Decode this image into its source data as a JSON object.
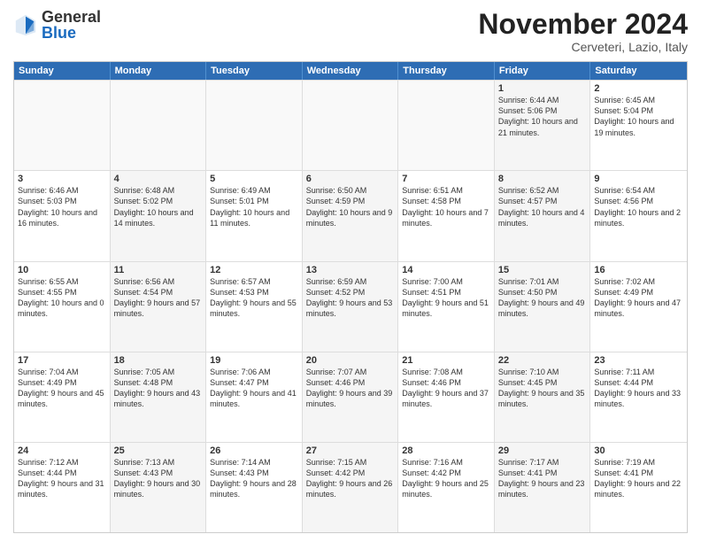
{
  "logo": {
    "general": "General",
    "blue": "Blue"
  },
  "title": "November 2024",
  "location": "Cerveteri, Lazio, Italy",
  "header_days": [
    "Sunday",
    "Monday",
    "Tuesday",
    "Wednesday",
    "Thursday",
    "Friday",
    "Saturday"
  ],
  "rows": [
    [
      {
        "day": "",
        "info": "",
        "shaded": false,
        "empty": true
      },
      {
        "day": "",
        "info": "",
        "shaded": false,
        "empty": true
      },
      {
        "day": "",
        "info": "",
        "shaded": false,
        "empty": true
      },
      {
        "day": "",
        "info": "",
        "shaded": false,
        "empty": true
      },
      {
        "day": "",
        "info": "",
        "shaded": false,
        "empty": true
      },
      {
        "day": "1",
        "info": "Sunrise: 6:44 AM\nSunset: 5:06 PM\nDaylight: 10 hours and 21 minutes.",
        "shaded": true,
        "empty": false
      },
      {
        "day": "2",
        "info": "Sunrise: 6:45 AM\nSunset: 5:04 PM\nDaylight: 10 hours and 19 minutes.",
        "shaded": false,
        "empty": false
      }
    ],
    [
      {
        "day": "3",
        "info": "Sunrise: 6:46 AM\nSunset: 5:03 PM\nDaylight: 10 hours and 16 minutes.",
        "shaded": false,
        "empty": false
      },
      {
        "day": "4",
        "info": "Sunrise: 6:48 AM\nSunset: 5:02 PM\nDaylight: 10 hours and 14 minutes.",
        "shaded": true,
        "empty": false
      },
      {
        "day": "5",
        "info": "Sunrise: 6:49 AM\nSunset: 5:01 PM\nDaylight: 10 hours and 11 minutes.",
        "shaded": false,
        "empty": false
      },
      {
        "day": "6",
        "info": "Sunrise: 6:50 AM\nSunset: 4:59 PM\nDaylight: 10 hours and 9 minutes.",
        "shaded": true,
        "empty": false
      },
      {
        "day": "7",
        "info": "Sunrise: 6:51 AM\nSunset: 4:58 PM\nDaylight: 10 hours and 7 minutes.",
        "shaded": false,
        "empty": false
      },
      {
        "day": "8",
        "info": "Sunrise: 6:52 AM\nSunset: 4:57 PM\nDaylight: 10 hours and 4 minutes.",
        "shaded": true,
        "empty": false
      },
      {
        "day": "9",
        "info": "Sunrise: 6:54 AM\nSunset: 4:56 PM\nDaylight: 10 hours and 2 minutes.",
        "shaded": false,
        "empty": false
      }
    ],
    [
      {
        "day": "10",
        "info": "Sunrise: 6:55 AM\nSunset: 4:55 PM\nDaylight: 10 hours and 0 minutes.",
        "shaded": false,
        "empty": false
      },
      {
        "day": "11",
        "info": "Sunrise: 6:56 AM\nSunset: 4:54 PM\nDaylight: 9 hours and 57 minutes.",
        "shaded": true,
        "empty": false
      },
      {
        "day": "12",
        "info": "Sunrise: 6:57 AM\nSunset: 4:53 PM\nDaylight: 9 hours and 55 minutes.",
        "shaded": false,
        "empty": false
      },
      {
        "day": "13",
        "info": "Sunrise: 6:59 AM\nSunset: 4:52 PM\nDaylight: 9 hours and 53 minutes.",
        "shaded": true,
        "empty": false
      },
      {
        "day": "14",
        "info": "Sunrise: 7:00 AM\nSunset: 4:51 PM\nDaylight: 9 hours and 51 minutes.",
        "shaded": false,
        "empty": false
      },
      {
        "day": "15",
        "info": "Sunrise: 7:01 AM\nSunset: 4:50 PM\nDaylight: 9 hours and 49 minutes.",
        "shaded": true,
        "empty": false
      },
      {
        "day": "16",
        "info": "Sunrise: 7:02 AM\nSunset: 4:49 PM\nDaylight: 9 hours and 47 minutes.",
        "shaded": false,
        "empty": false
      }
    ],
    [
      {
        "day": "17",
        "info": "Sunrise: 7:04 AM\nSunset: 4:49 PM\nDaylight: 9 hours and 45 minutes.",
        "shaded": false,
        "empty": false
      },
      {
        "day": "18",
        "info": "Sunrise: 7:05 AM\nSunset: 4:48 PM\nDaylight: 9 hours and 43 minutes.",
        "shaded": true,
        "empty": false
      },
      {
        "day": "19",
        "info": "Sunrise: 7:06 AM\nSunset: 4:47 PM\nDaylight: 9 hours and 41 minutes.",
        "shaded": false,
        "empty": false
      },
      {
        "day": "20",
        "info": "Sunrise: 7:07 AM\nSunset: 4:46 PM\nDaylight: 9 hours and 39 minutes.",
        "shaded": true,
        "empty": false
      },
      {
        "day": "21",
        "info": "Sunrise: 7:08 AM\nSunset: 4:46 PM\nDaylight: 9 hours and 37 minutes.",
        "shaded": false,
        "empty": false
      },
      {
        "day": "22",
        "info": "Sunrise: 7:10 AM\nSunset: 4:45 PM\nDaylight: 9 hours and 35 minutes.",
        "shaded": true,
        "empty": false
      },
      {
        "day": "23",
        "info": "Sunrise: 7:11 AM\nSunset: 4:44 PM\nDaylight: 9 hours and 33 minutes.",
        "shaded": false,
        "empty": false
      }
    ],
    [
      {
        "day": "24",
        "info": "Sunrise: 7:12 AM\nSunset: 4:44 PM\nDaylight: 9 hours and 31 minutes.",
        "shaded": false,
        "empty": false
      },
      {
        "day": "25",
        "info": "Sunrise: 7:13 AM\nSunset: 4:43 PM\nDaylight: 9 hours and 30 minutes.",
        "shaded": true,
        "empty": false
      },
      {
        "day": "26",
        "info": "Sunrise: 7:14 AM\nSunset: 4:43 PM\nDaylight: 9 hours and 28 minutes.",
        "shaded": false,
        "empty": false
      },
      {
        "day": "27",
        "info": "Sunrise: 7:15 AM\nSunset: 4:42 PM\nDaylight: 9 hours and 26 minutes.",
        "shaded": true,
        "empty": false
      },
      {
        "day": "28",
        "info": "Sunrise: 7:16 AM\nSunset: 4:42 PM\nDaylight: 9 hours and 25 minutes.",
        "shaded": false,
        "empty": false
      },
      {
        "day": "29",
        "info": "Sunrise: 7:17 AM\nSunset: 4:41 PM\nDaylight: 9 hours and 23 minutes.",
        "shaded": true,
        "empty": false
      },
      {
        "day": "30",
        "info": "Sunrise: 7:19 AM\nSunset: 4:41 PM\nDaylight: 9 hours and 22 minutes.",
        "shaded": false,
        "empty": false
      }
    ]
  ]
}
